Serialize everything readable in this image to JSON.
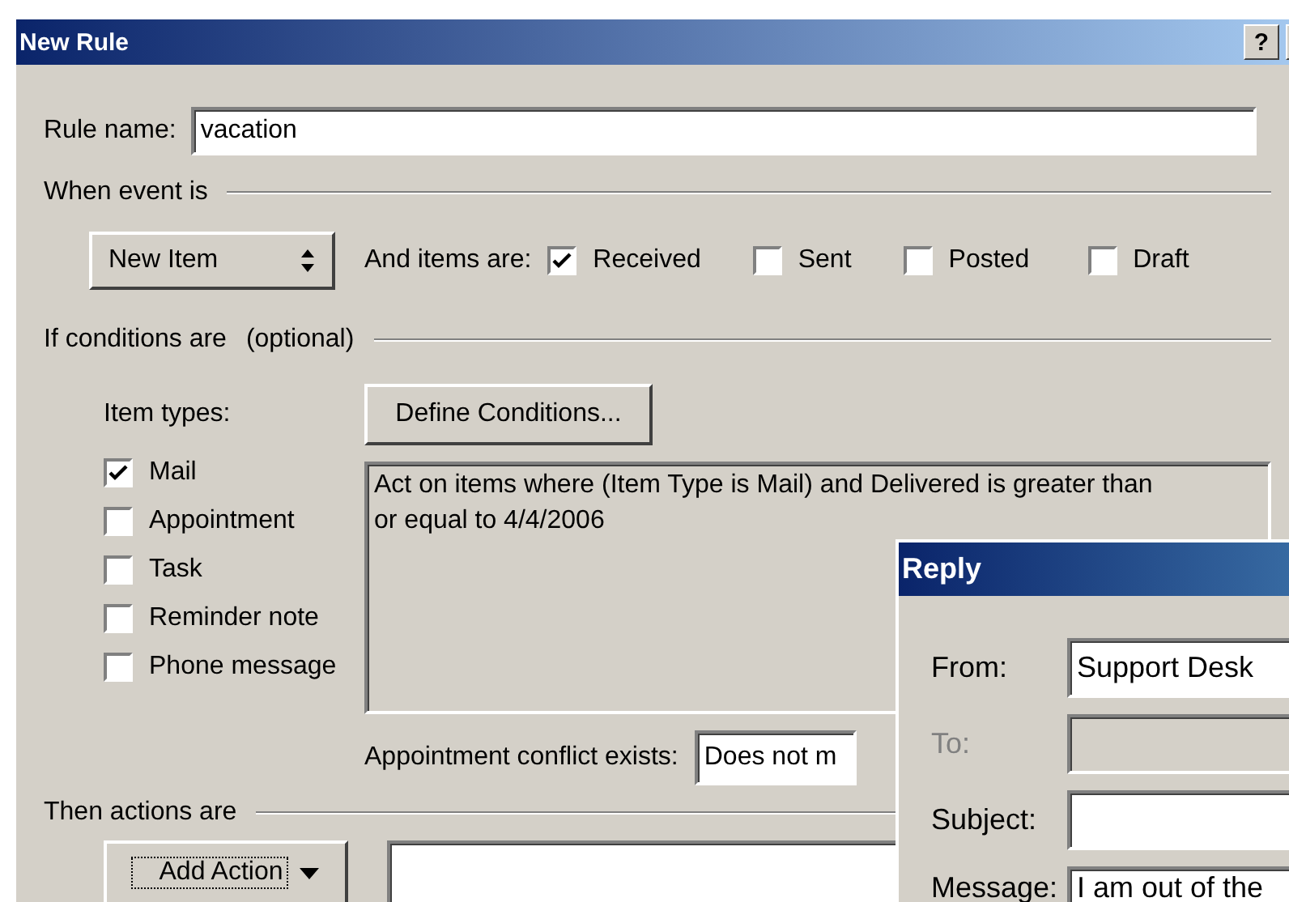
{
  "window": {
    "title": "New Rule",
    "help": "?"
  },
  "rule_name": {
    "label": "Rule name:",
    "value": "vacation"
  },
  "event": {
    "heading": "When event is",
    "selected": "New Item",
    "items_label": "And items are:",
    "options": [
      {
        "label": "Received",
        "checked": true
      },
      {
        "label": "Sent",
        "checked": false
      },
      {
        "label": "Posted",
        "checked": false
      },
      {
        "label": "Draft",
        "checked": false
      }
    ]
  },
  "conditions": {
    "heading": "If conditions are",
    "note": "(optional)",
    "item_types_label": "Item types:",
    "item_types": [
      {
        "label": "Mail",
        "checked": true
      },
      {
        "label": "Appointment",
        "checked": false
      },
      {
        "label": "Task",
        "checked": false
      },
      {
        "label": "Reminder note",
        "checked": false
      },
      {
        "label": "Phone message",
        "checked": false
      }
    ],
    "define_button": "Define Conditions...",
    "description": "Act on items where (Item Type is Mail) and Delivered is greater than or equal to 4/4/2006",
    "conflict_label": "Appointment conflict exists:",
    "conflict_value": "Does not m"
  },
  "actions": {
    "heading": "Then actions are",
    "add_button": "Add Action"
  },
  "reply": {
    "title": "Reply",
    "fields": [
      {
        "label": "From:",
        "value": "Support Desk",
        "disabled": false
      },
      {
        "label": "To:",
        "disabled": true
      },
      {
        "label": "Subject:",
        "disabled": false
      },
      {
        "label": "Message:",
        "value": "I am out of the",
        "disabled": false
      }
    ]
  }
}
